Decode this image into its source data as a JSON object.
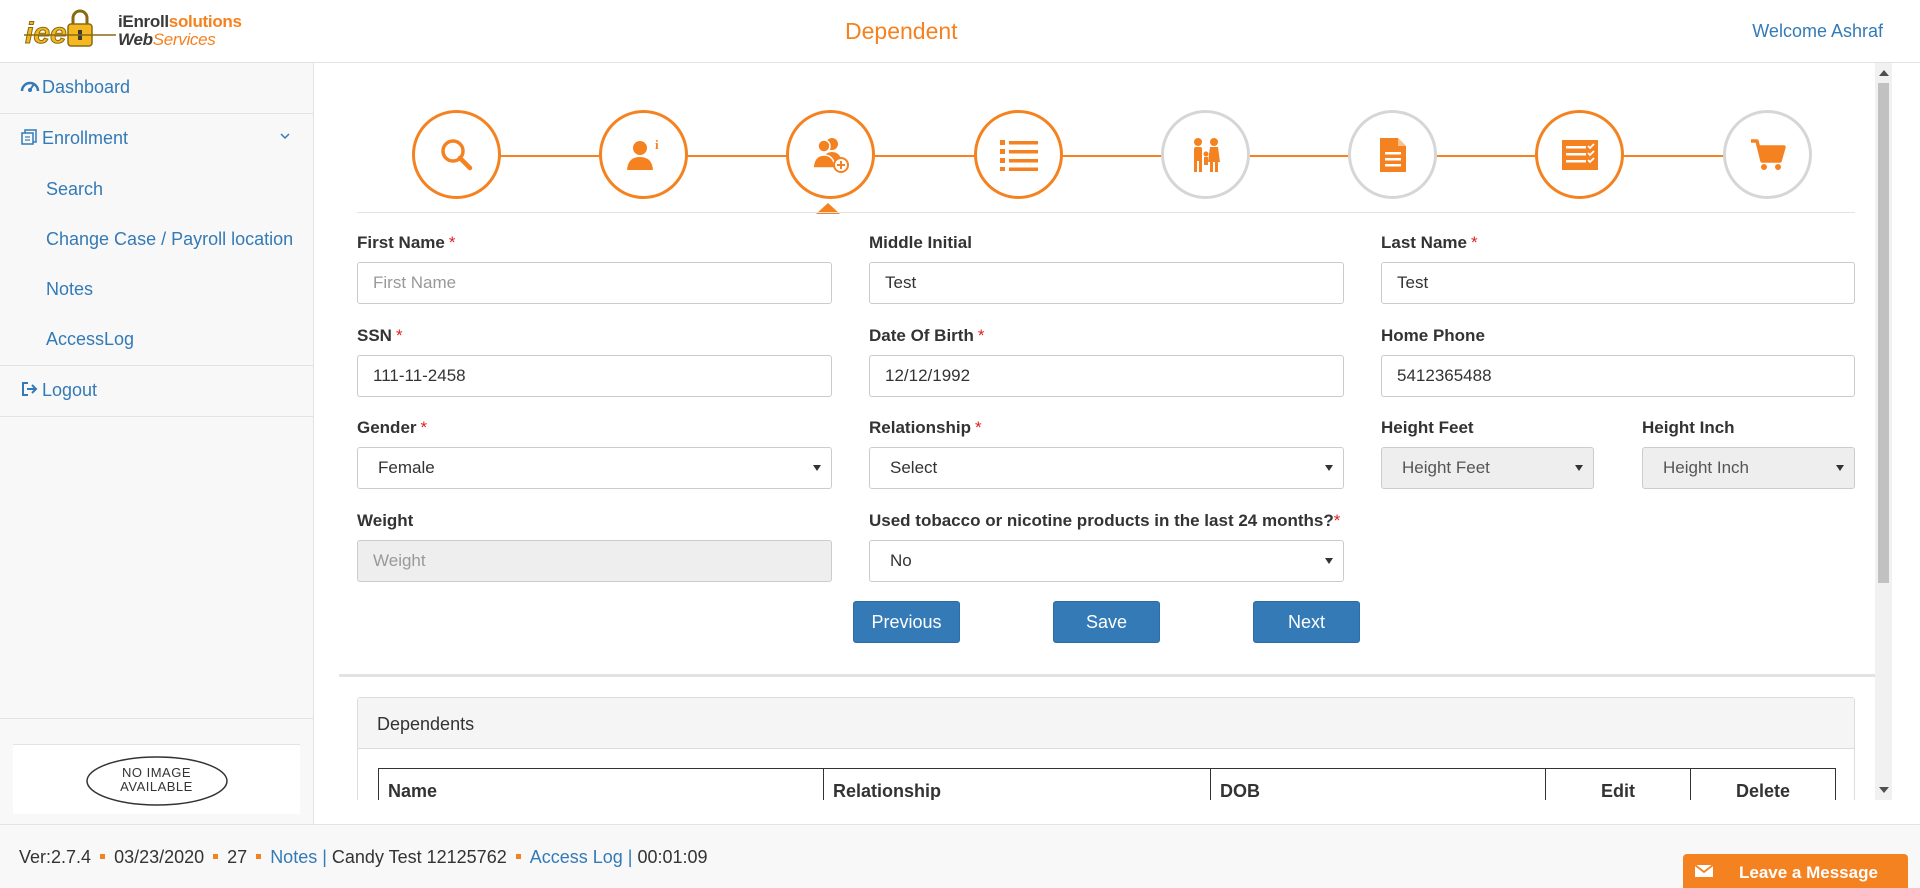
{
  "header": {
    "logo_line1a": "iEnroll",
    "logo_line1b": "solutions",
    "logo_line2a": "Web",
    "logo_line2b": "Services",
    "title": "Dependent",
    "welcome": "Welcome Ashraf"
  },
  "sidebar": {
    "dashboard": "Dashboard",
    "enrollment": "Enrollment",
    "sub_items": [
      "Search",
      "Change Case / Payroll location",
      "Notes",
      "AccessLog"
    ],
    "logout": "Logout",
    "no_image_line1": "NO IMAGE",
    "no_image_line2": "AVAILABLE"
  },
  "stepper": {
    "steps": [
      {
        "icon": "search-icon",
        "active": true
      },
      {
        "icon": "person-info-icon",
        "active": true
      },
      {
        "icon": "add-dependent-icon",
        "active": true,
        "current": true
      },
      {
        "icon": "list-icon",
        "active": true
      },
      {
        "icon": "family-icon",
        "active": false
      },
      {
        "icon": "document-icon",
        "active": false
      },
      {
        "icon": "checklist-icon",
        "active": true
      },
      {
        "icon": "cart-icon",
        "active": false
      }
    ]
  },
  "form": {
    "first_name": {
      "label": "First Name",
      "required": "*",
      "placeholder": "First Name",
      "value": ""
    },
    "middle_initial": {
      "label": "Middle Initial",
      "value": "Test"
    },
    "last_name": {
      "label": "Last Name",
      "required": "*",
      "value": "Test"
    },
    "ssn": {
      "label": "SSN",
      "required": "*",
      "value": "111-11-2458"
    },
    "dob": {
      "label": "Date Of Birth",
      "required": "*",
      "value": "12/12/1992"
    },
    "home_phone": {
      "label": "Home Phone",
      "value": "5412365488"
    },
    "gender": {
      "label": "Gender",
      "required": "*",
      "value": "Female"
    },
    "relationship": {
      "label": "Relationship",
      "required": "*",
      "value": "Select"
    },
    "height_feet": {
      "label": "Height Feet",
      "value": "Height Feet"
    },
    "height_inch": {
      "label": "Height Inch",
      "value": "Height Inch"
    },
    "weight": {
      "label": "Weight",
      "placeholder": "Weight"
    },
    "tobacco": {
      "label": "Used tobacco or nicotine products in the last 24 months?",
      "required": "*",
      "value": "No"
    }
  },
  "buttons": {
    "previous": "Previous",
    "save": "Save",
    "next": "Next"
  },
  "dependents": {
    "title": "Dependents",
    "columns": [
      "Name",
      "Relationship",
      "DOB",
      "Edit",
      "Delete"
    ]
  },
  "footer": {
    "version": "Ver:2.7.4",
    "date": "03/23/2020",
    "count": "27",
    "notes_link": "Notes |",
    "candy": "Candy Test 12125762",
    "access_link": "Access Log |",
    "timer": "00:01:09",
    "leave_message": "Leave a Message"
  },
  "colors": {
    "accent": "#f58220",
    "link": "#337ab7",
    "button": "#337ab7",
    "required": "#e02020"
  }
}
